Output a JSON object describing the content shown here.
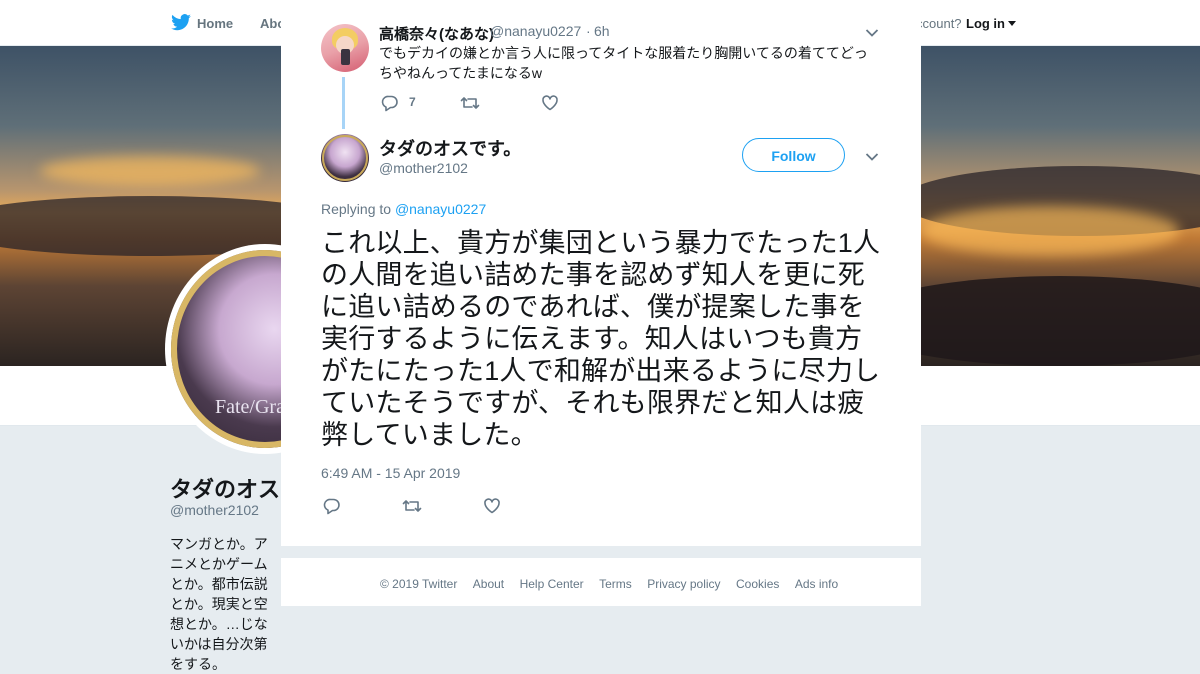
{
  "colors": {
    "accent": "#1da1f2",
    "text_primary": "#14171a",
    "text_secondary": "#657786",
    "thread_line": "#a7d4f7",
    "background": "#e6ecf0"
  },
  "topnav": {
    "home_label": "Home",
    "about_label": "Abo",
    "account_prompt": "ccount?",
    "login_label": "Log in",
    "icons": [
      "twitter-bird-icon",
      "caret-down-icon"
    ]
  },
  "profile_background": {
    "name": "タダのオス",
    "handle": "@mother2102",
    "bio": "マンガとか。アニメとかゲームとか。都市伝説とか。現実と空想とか。…じないかは自分次第をする。",
    "avatar_text": "Fate/Grand"
  },
  "modal": {
    "close_icon": "close-x-icon",
    "reply_tweet": {
      "name": "高橋奈々(なあな)",
      "handle": "@nanayu0227",
      "separator": "·",
      "time": "6h",
      "text": "でもデカイの嫌とか言う人に限ってタイトな服着たり胸開いてるの着ててどっちやねんってたまになるw",
      "reply_count": "7",
      "icons": [
        "reply-icon",
        "retweet-icon",
        "like-icon",
        "chevron-down-icon"
      ]
    },
    "main_tweet": {
      "name": "タダのオスです。",
      "handle": "@mother2102",
      "follow_label": "Follow",
      "replying_to_label": "Replying to",
      "replying_to_handle": "@nanayu0227",
      "text": "これ以上、貴方が集団という暴力でたった1人の人間を追い詰めた事を認めず知人を更に死に追い詰めるのであれば、僕が提案した事を実行するように伝えます。知人はいつも貴方がたにたった1人で和解が出来るように尽力していたそうですが、それも限界だと知人は疲弊していました。",
      "timestamp": "6:49 AM - 15 Apr 2019",
      "icons": [
        "reply-icon",
        "retweet-icon",
        "like-icon",
        "chevron-down-icon"
      ]
    }
  },
  "footer": {
    "links": [
      "© 2019 Twitter",
      "About",
      "Help Center",
      "Terms",
      "Privacy policy",
      "Cookies",
      "Ads info"
    ]
  }
}
